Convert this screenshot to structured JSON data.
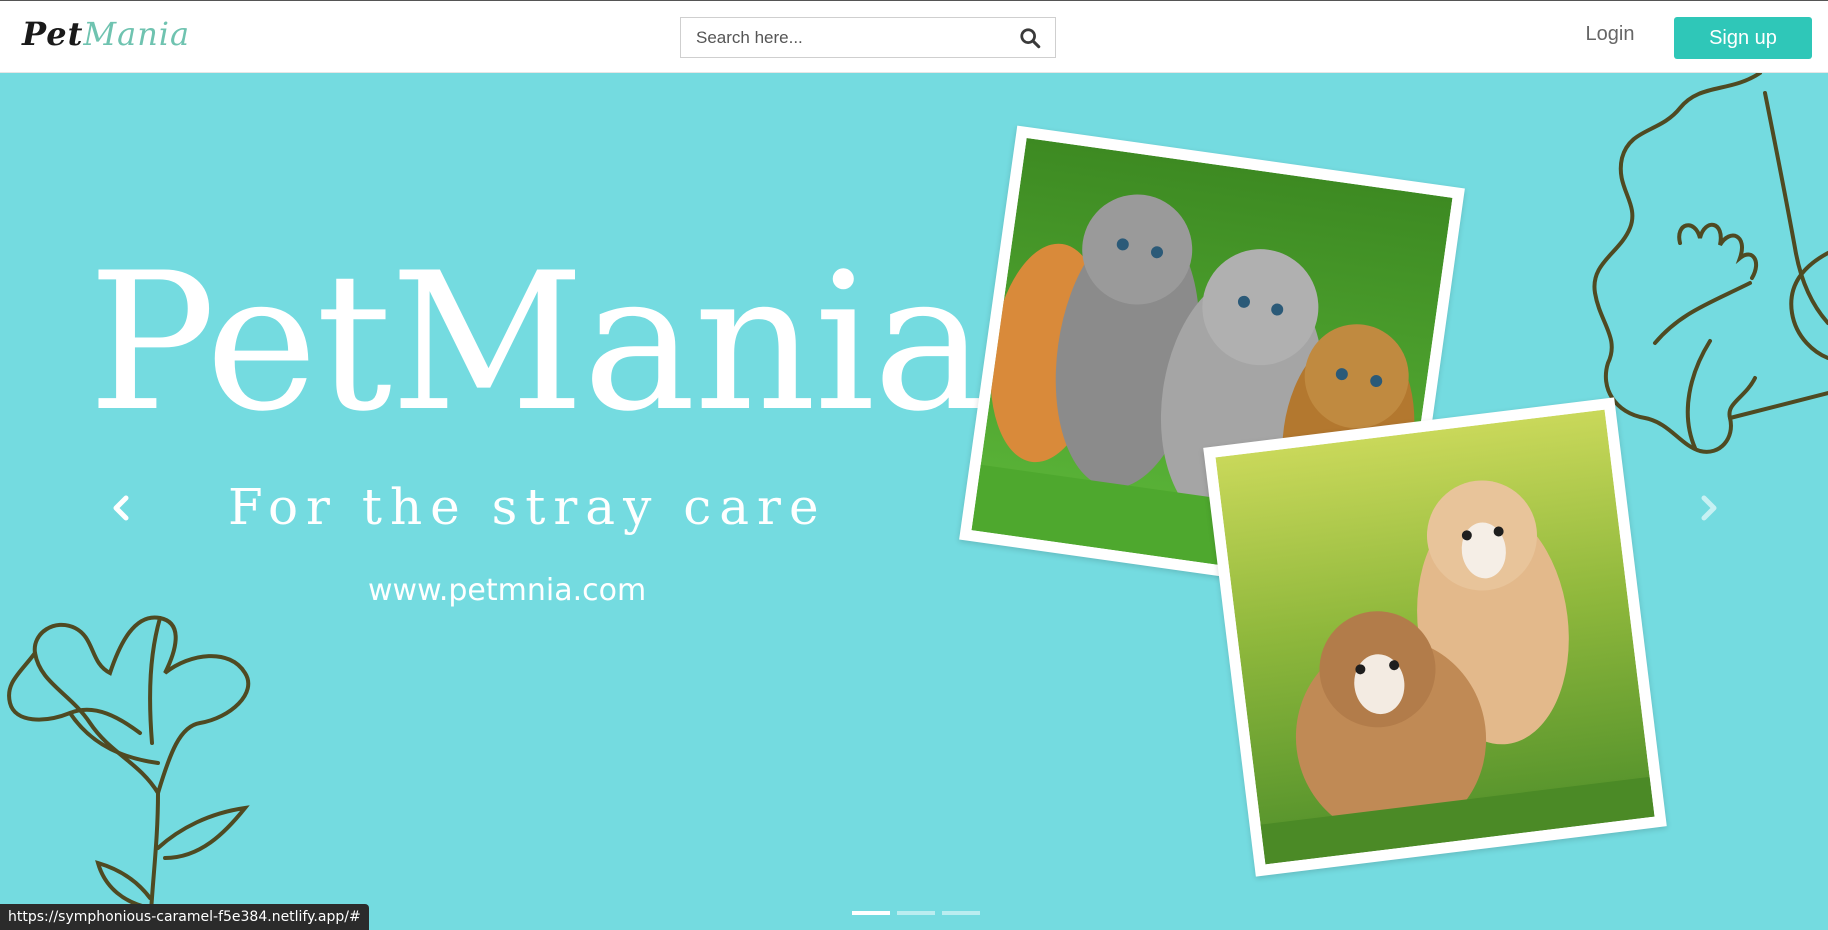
{
  "navbar": {
    "brand_part1": "Pet",
    "brand_part2": "Mania",
    "search_placeholder": "Search here...",
    "search_icon": "search-icon",
    "login_label": "Login",
    "signup_label": "Sign up"
  },
  "hero": {
    "title": "PetMania",
    "tagline": "For the stray care",
    "url": "www.petmnia.com",
    "prev_icon": "chevron-left-icon",
    "next_icon": "chevron-right-icon",
    "slides_total": 3,
    "active_slide": 1,
    "photos": [
      {
        "subject": "kittens-on-grass"
      },
      {
        "subject": "puppies-on-grass"
      }
    ]
  },
  "status_bar": {
    "url": "https://symphonious-caramel-f5e384.netlify.app/#"
  },
  "colors": {
    "hero_background": "#74dbe0",
    "signup_button": "#2fc7b8",
    "brand_accent": "#6fc3b0",
    "flower_stroke": "#4f4a22"
  }
}
